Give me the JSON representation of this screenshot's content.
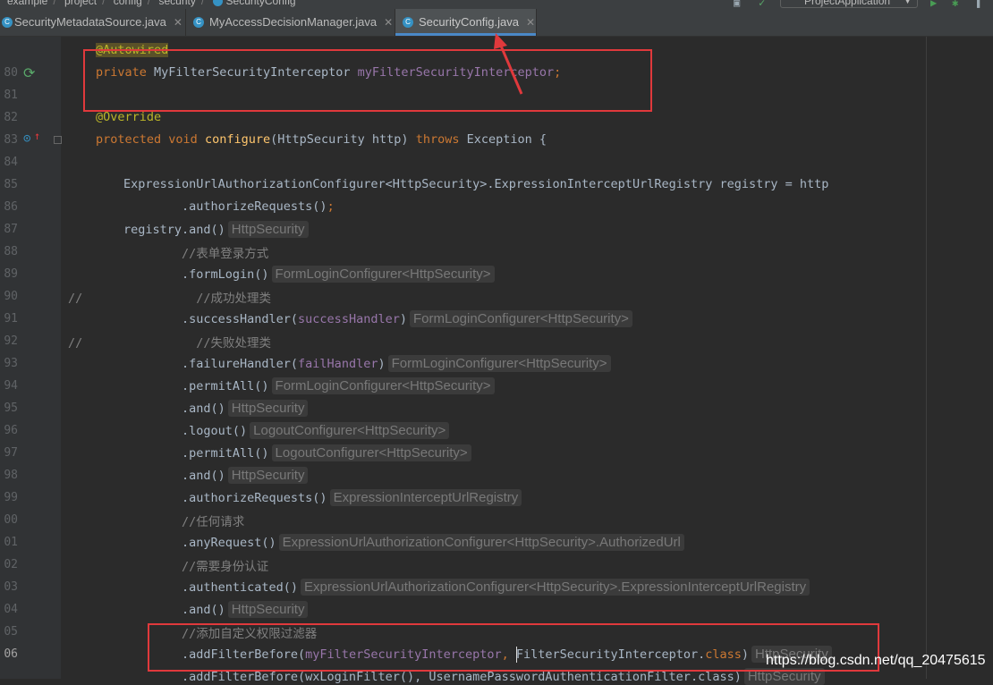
{
  "breadcrumb": [
    "example",
    "project",
    "config",
    "security",
    "SecurityConfig"
  ],
  "run_config": "ProjectApplication",
  "tabs": [
    {
      "label": "SecurityMetadataSource.java",
      "active": false
    },
    {
      "label": "MyAccessDecisionManager.java",
      "active": false
    },
    {
      "label": "SecurityConfig.java",
      "active": true
    }
  ],
  "editor": {
    "line_numbers": [
      "",
      "80",
      "81",
      "82",
      "83",
      "84",
      "85",
      "86",
      "87",
      "88",
      "89",
      "90",
      "91",
      "92",
      "93",
      "94",
      "95",
      "96",
      "97",
      "98",
      "99",
      "00",
      "01",
      "02",
      "03",
      "04",
      "05",
      "06",
      ""
    ],
    "current_line": "06",
    "code": {
      "l79_annotation": "@Autowired",
      "l80_private": "private",
      "l80_type": "MyFilterSecurityInterceptor",
      "l80_field": "myFilterSecurityInterceptor",
      "l82_override": "@Override",
      "l83_protected": "protected",
      "l83_void": "void",
      "l83_method": "configure",
      "l83_params": "(HttpSecurity http)",
      "l83_throws": "throws",
      "l83_exception": "Exception {",
      "l85": "ExpressionUrlAuthorizationConfigurer<HttpSecurity>.ExpressionInterceptUrlRegistry registry = http",
      "l86": ".authorizeRequests()",
      "l87": "registry.and()",
      "l88_comment": "//表单登录方式",
      "l89": ".formLogin()",
      "l90_comment": "//成功处理类",
      "l91_call": ".successHandler(",
      "l91_arg": "successHandler",
      "l92_comment": "//失败处理类",
      "l93_call": ".failureHandler(",
      "l93_arg": "failHandler",
      "l94": ".permitAll()",
      "l95": ".and()",
      "l96": ".logout()",
      "l97": ".permitAll()",
      "l98": ".and()",
      "l99": ".authorizeRequests()",
      "l100_comment": "//任何请求",
      "l101": ".anyRequest()",
      "l102_comment": "//需要身份认证",
      "l103": ".authenticated()",
      "l104": ".and()",
      "l105_comment": "//添加自定义权限过滤器",
      "l106_call": ".addFilterBefore(",
      "l106_arg": "myFilterSecurityInterceptor",
      "l106_class": "FilterSecurityInterceptor",
      "l107": ".addFilterBefore(wxLoginFilter(), UsernamePasswordAuthenticationFilter.class)"
    },
    "hints": {
      "l87": "HttpSecurity",
      "l89": "FormLoginConfigurer<HttpSecurity>",
      "l91": "FormLoginConfigurer<HttpSecurity>",
      "l93": "FormLoginConfigurer<HttpSecurity>",
      "l94": "FormLoginConfigurer<HttpSecurity>",
      "l95": "HttpSecurity",
      "l96": "LogoutConfigurer<HttpSecurity>",
      "l97": "LogoutConfigurer<HttpSecurity>",
      "l98": "HttpSecurity",
      "l99": "ExpressionInterceptUrlRegistry",
      "l101": "ExpressionUrlAuthorizationConfigurer<HttpSecurity>.AuthorizedUrl",
      "l103": "ExpressionUrlAuthorizationConfigurer<HttpSecurity>.ExpressionInterceptUrlRegistry",
      "l104": "HttpSecurity",
      "l106": "HttpSecurity",
      "l107": "HttpSecurity"
    }
  },
  "watermark": "https://blog.csdn.net/qq_20475615",
  "colors": {
    "keyword": "#cc7832",
    "field": "#9876aa",
    "annotation": "#bbb529",
    "method": "#ffc66d",
    "comment": "#808080",
    "highlight_box": "#e0393c"
  }
}
